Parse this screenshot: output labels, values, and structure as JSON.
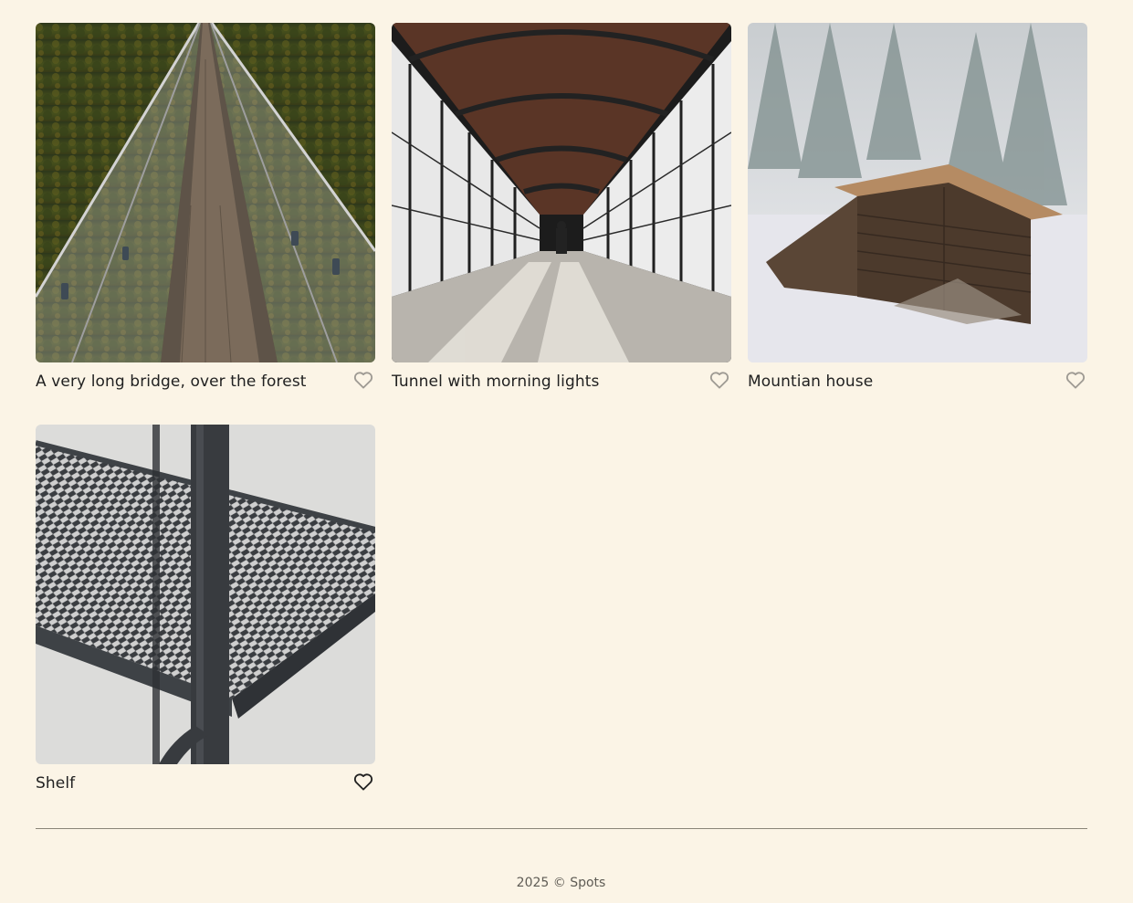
{
  "cards": [
    {
      "title": "A very long bridge, over the forest",
      "liked": false
    },
    {
      "title": "Tunnel with morning lights",
      "liked": false
    },
    {
      "title": "Mountian house",
      "liked": false
    },
    {
      "title": "Shelf",
      "liked": true
    }
  ],
  "footer": {
    "copyright": "2025 © Spots"
  },
  "colors": {
    "background": "#fbf4e6",
    "text": "#212121",
    "heart_inactive": "#9e9a93",
    "heart_active": "#212121",
    "divider": "#8a8578"
  },
  "icons": {
    "like": "heart-icon"
  }
}
